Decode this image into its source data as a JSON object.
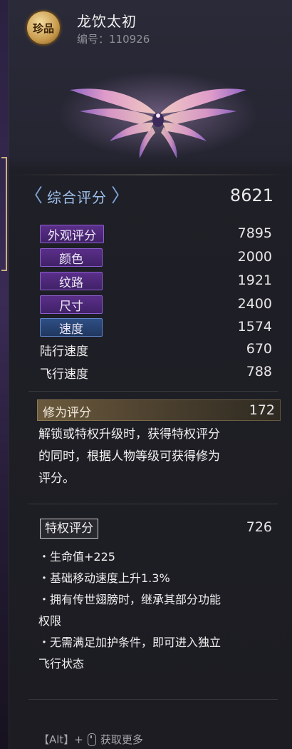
{
  "header": {
    "rarity_badge": "珍品",
    "item_name": "龙饮太初",
    "item_code": "编号：110926"
  },
  "overall": {
    "label": "综合评分",
    "value": "8621"
  },
  "scores": [
    {
      "label": "外观评分",
      "value": "7895",
      "style": "purple"
    },
    {
      "label": "颜色",
      "value": "2000",
      "style": "purple"
    },
    {
      "label": "纹路",
      "value": "1921",
      "style": "purple"
    },
    {
      "label": "尺寸",
      "value": "2400",
      "style": "purple"
    },
    {
      "label": "速度",
      "value": "1574",
      "style": "blue"
    },
    {
      "label": "陆行速度",
      "value": "670",
      "style": "plain"
    },
    {
      "label": "飞行速度",
      "value": "788",
      "style": "plain"
    }
  ],
  "cultivation": {
    "label": "修为评分",
    "value": "172",
    "description_lines": [
      "解锁或特权升级时，获得特权评分",
      "的同时，根据人物等级可获得修为",
      "评分。"
    ]
  },
  "privilege": {
    "label": "特权评分",
    "value": "726",
    "bullets": [
      "・生命值+225",
      "・基础移动速度上升1.3%",
      "・拥有传世翅膀时，继承其部分功能",
      "权限",
      "・无需满足加护条件，即可进入独立",
      "飞行状态"
    ]
  },
  "footer": {
    "key_hint": "【Alt】+",
    "action": "获取更多"
  },
  "colors": {
    "overall_label": "#9fc2ee",
    "tag_purple": "#5b2f8a",
    "tag_blue": "#2f4f86",
    "rarity_gold": "#c89a4c"
  }
}
